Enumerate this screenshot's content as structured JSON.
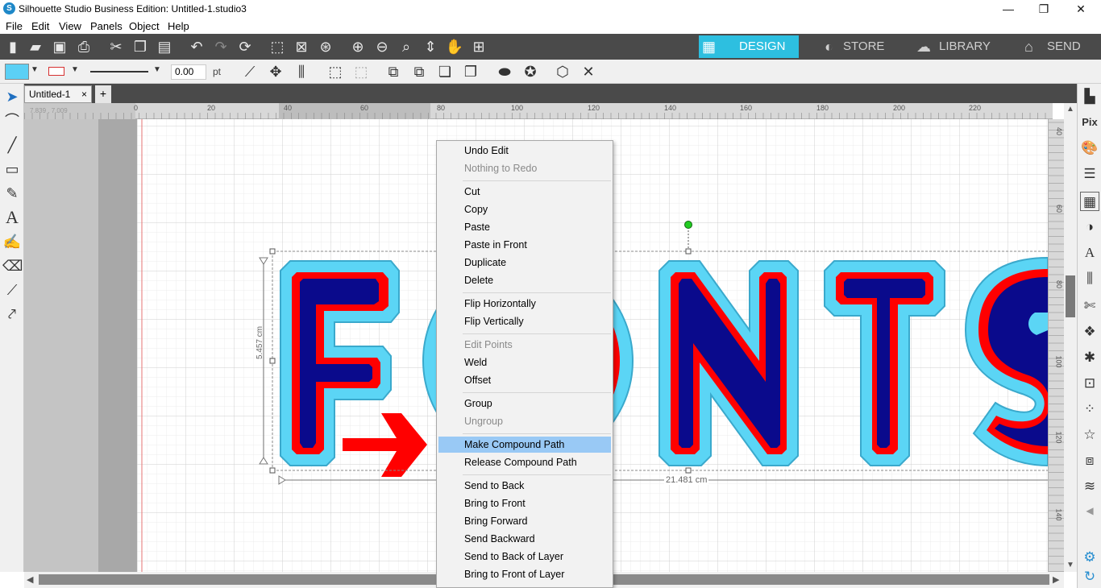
{
  "window": {
    "title": "Silhouette Studio Business Edition: Untitled-1.studio3",
    "logo_letter": "S",
    "minimize": "—",
    "restore": "❐",
    "close": "✕"
  },
  "menu": [
    "File",
    "Edit",
    "View",
    "Panels",
    "Object",
    "Help"
  ],
  "mode_tabs": {
    "design": "DESIGN",
    "store": "STORE",
    "library": "LIBRARY",
    "send": "SEND",
    "active": "DESIGN",
    "active_color": "#2dbfe0"
  },
  "style_bar": {
    "fill_color": "#5bd0f5",
    "line_color": "#d63030",
    "line_width_value": "0.00",
    "line_width_unit": "pt"
  },
  "document_tab": {
    "name": "Untitled-1",
    "close": "×",
    "add": "+"
  },
  "rulers": {
    "horizontal_ticks": [
      "0",
      "20",
      "40",
      "60",
      "80",
      "100",
      "120",
      "140",
      "160",
      "180",
      "200",
      "220"
    ],
    "vertical_ticks": [
      "40",
      "60",
      "80",
      "100",
      "120",
      "140"
    ],
    "cursor_readout": "7.839 , 7.009"
  },
  "canvas": {
    "letters": [
      "F",
      "N",
      "T",
      "S"
    ],
    "height_dimension": "5.457 cm",
    "width_dimension": "21.481 cm",
    "colors": {
      "offset": "#5bd5f5",
      "outline": "#ff0000",
      "fill": "#0a0a8c",
      "arrow": "#ff0000"
    }
  },
  "context_menu": {
    "items": [
      {
        "label": "Undo Edit",
        "enabled": true
      },
      {
        "label": "Nothing to Redo",
        "enabled": false
      },
      {
        "sep": true
      },
      {
        "label": "Cut",
        "enabled": true
      },
      {
        "label": "Copy",
        "enabled": true
      },
      {
        "label": "Paste",
        "enabled": true
      },
      {
        "label": "Paste in Front",
        "enabled": true
      },
      {
        "label": "Duplicate",
        "enabled": true
      },
      {
        "label": "Delete",
        "enabled": true
      },
      {
        "sep": true
      },
      {
        "label": "Flip Horizontally",
        "enabled": true
      },
      {
        "label": "Flip Vertically",
        "enabled": true
      },
      {
        "sep": true
      },
      {
        "label": "Edit Points",
        "enabled": false
      },
      {
        "label": "Weld",
        "enabled": true
      },
      {
        "label": "Offset",
        "enabled": true
      },
      {
        "sep": true
      },
      {
        "label": "Group",
        "enabled": true
      },
      {
        "label": "Ungroup",
        "enabled": false
      },
      {
        "sep": true
      },
      {
        "label": "Make Compound Path",
        "enabled": true,
        "highlighted": true
      },
      {
        "label": "Release Compound Path",
        "enabled": true
      },
      {
        "sep": true
      },
      {
        "label": "Send to Back",
        "enabled": true
      },
      {
        "label": "Bring to Front",
        "enabled": true
      },
      {
        "label": "Bring Forward",
        "enabled": true
      },
      {
        "label": "Send Backward",
        "enabled": true
      },
      {
        "label": "Send to Back of Layer",
        "enabled": true
      },
      {
        "label": "Bring to Front of Layer",
        "enabled": true
      }
    ]
  }
}
